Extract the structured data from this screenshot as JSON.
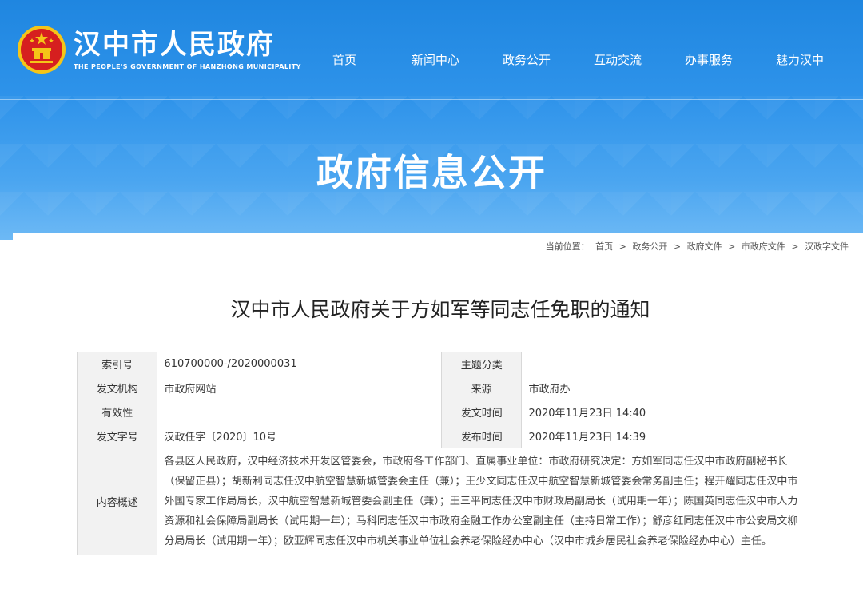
{
  "header": {
    "title": "汉中市人民政府",
    "subtitle": "THE PEOPLE'S GOVERNMENT OF HANZHONG MUNICIPALITY"
  },
  "nav": {
    "items": [
      "首页",
      "新闻中心",
      "政务公开",
      "互动交流",
      "办事服务",
      "魅力汉中"
    ]
  },
  "banner": {
    "title": "政府信息公开"
  },
  "breadcrumb": {
    "label": "当前位置：",
    "items": [
      "首页",
      "政务公开",
      "政府文件",
      "市政府文件",
      "汉政字文件"
    ],
    "sep": ">"
  },
  "document": {
    "title": "汉中市人民政府关于方如军等同志任免职的通知",
    "meta": {
      "index_label": "索引号",
      "index_value": "610700000-/2020000031",
      "topic_label": "主题分类",
      "topic_value": "",
      "issuer_label": "发文机构",
      "issuer_value": "市政府网站",
      "source_label": "来源",
      "source_value": "市政府办",
      "validity_label": "有效性",
      "validity_value": "",
      "issue_time_label": "发文时间",
      "issue_time_value": "2020年11月23日 14:40",
      "doc_no_label": "发文字号",
      "doc_no_value": "汉政任字〔2020〕10号",
      "publish_time_label": "发布时间",
      "publish_time_value": "2020年11月23日 14:39",
      "summary_label": "内容概述",
      "summary_value": "各县区人民政府，汉中经济技术开发区管委会，市政府各工作部门、直属事业单位：市政府研究决定：方如军同志任汉中市政府副秘书长（保留正县）；胡新利同志任汉中航空智慧新城管委会主任（兼）；王少文同志任汉中航空智慧新城管委会常务副主任；程开耀同志任汉中市外国专家工作局局长，汉中航空智慧新城管委会副主任（兼）；王三平同志任汉中市财政局副局长（试用期一年）；陈国英同志任汉中市人力资源和社会保障局副局长（试用期一年）；马科同志任汉中市政府金融工作办公室副主任（主持日常工作）；舒彦红同志任汉中市公安局文柳分局局长（试用期一年）；欧亚辉同志任汉中市机关事业单位社会养老保险经办中心（汉中市城乡居民社会养老保险经办中心）主任。"
    }
  },
  "colors": {
    "brand_blue": "#2e93ea",
    "emblem_red": "#d61f1f",
    "emblem_gold": "#f5c518"
  }
}
